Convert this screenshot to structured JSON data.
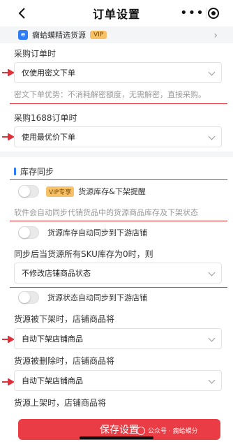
{
  "header": {
    "title": "订单设置"
  },
  "app": {
    "name": "瘸蛤蟆精选货源",
    "vip": "VIP"
  },
  "order": {
    "purchase_label": "采购订单时",
    "purchase_value": "仅使用密文下单",
    "hint": "密文下单优势：不消耗解密额度，无需解密，直接采购。",
    "p1688_label": "采购1688订单时",
    "p1688_value": "使用最优价下单"
  },
  "stock": {
    "section_title": "库存同步",
    "toggle1_vip": "VIP专享",
    "toggle1_label": "货源库存&下架提醒",
    "toggle1_hint": "软件会自动同步代销货品中的货源商品库存及下架状态",
    "toggle2_label": "货源库存自动同步到下游店铺",
    "sku_label": "同步后当货源所有SKU库存为0时，则",
    "sku_value": "不修改店铺商品状态",
    "toggle3_label": "货源状态自动同步到下游店铺",
    "offshelf_label": "货源被下架时，店铺商品将",
    "offshelf_value": "自动下架店铺商品",
    "deleted_label": "货源被删除时，店铺商品将",
    "deleted_value": "自动下架店铺商品",
    "onshelf_label": "货源上架时，店铺商品将"
  },
  "footer": {
    "save_label": "保存设置",
    "watermark": "公众号 · 瘸蛤蟆分"
  },
  "colors": {
    "accent_red": "#ea3c44",
    "accent_blue": "#2f7cf6",
    "vip_gold": "#f7c267"
  },
  "icons": [
    "back-icon",
    "more-icon",
    "target-icon",
    "app-logo-icon",
    "chevron-right-icon",
    "chevron-down-icon",
    "arrow-annotation-icon"
  ]
}
